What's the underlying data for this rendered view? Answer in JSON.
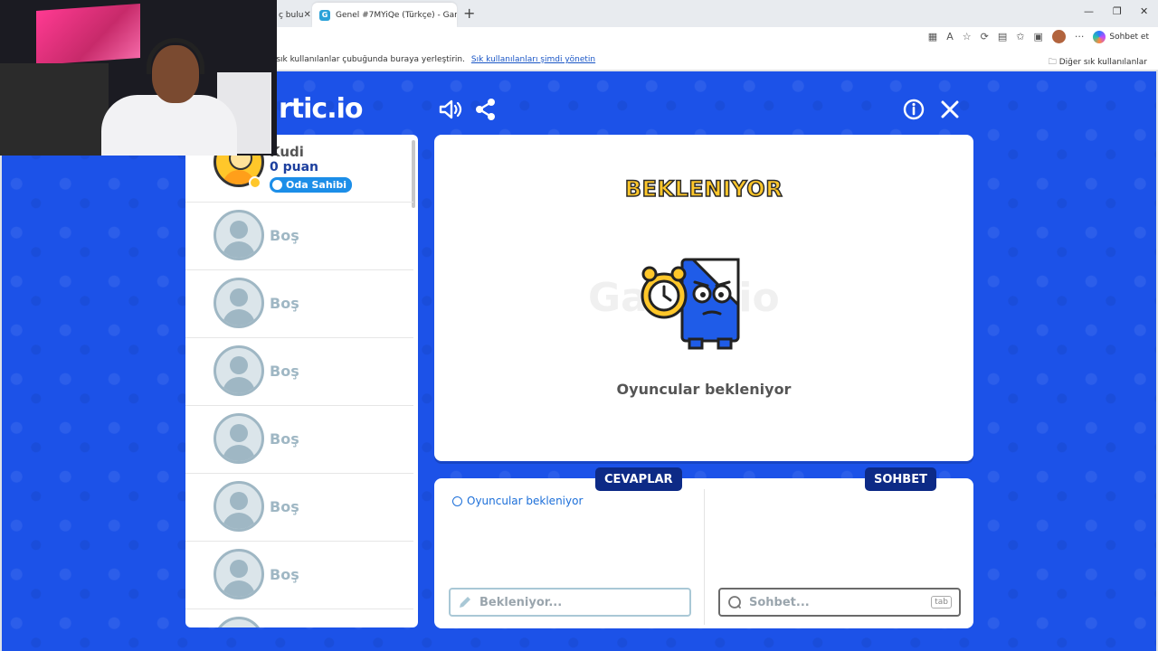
{
  "browser": {
    "tabs": [
      {
        "label": "ç bulu",
        "active": false
      },
      {
        "label": "Genel #7MYiQe (Türkçe) - Gartic.io",
        "active": true
      }
    ],
    "favorites_bar": {
      "message": "ı sık kullanılanlar çubuğunda buraya yerleştirin.",
      "link": "Sık kullanılanları şimdi yönetin",
      "others": "Diğer sık kullanılanlar"
    },
    "copilot_label": "Sohbet et"
  },
  "game": {
    "logo": "rtic.io",
    "players": [
      {
        "name": "Kudi",
        "points": "0 puan",
        "badge": "Oda Sahibi",
        "host": true
      },
      {
        "name": "Boş"
      },
      {
        "name": "Boş"
      },
      {
        "name": "Boş"
      },
      {
        "name": "Boş"
      },
      {
        "name": "Boş"
      },
      {
        "name": "Boş"
      }
    ],
    "status_title": "BEKLENIYOR",
    "status_subtitle": "Oyuncular bekleniyor",
    "watermark": "Gartic.io",
    "answers": {
      "tab": "CEVAPLAR",
      "info": "Oyuncular bekleniyor",
      "placeholder": "Bekleniyor..."
    },
    "chat": {
      "tab": "SOHBET",
      "placeholder": "Sohbet...",
      "shortcut": "tab"
    }
  },
  "colors": {
    "game_bg": "#1c52e8",
    "accent_yellow": "#ffc72a",
    "tab_navy": "#0d2a86"
  }
}
